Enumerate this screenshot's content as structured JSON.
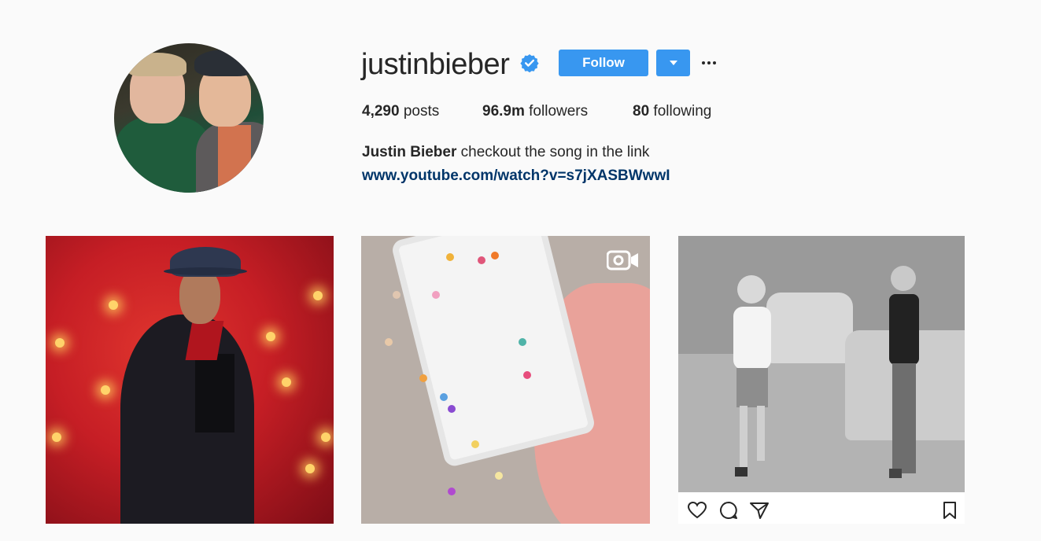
{
  "profile": {
    "username": "justinbieber",
    "verified": true,
    "follow_label": "Follow",
    "stats": {
      "posts_value": "4,290",
      "posts_label": "posts",
      "followers_value": "96.9m",
      "followers_label": "followers",
      "following_value": "80",
      "following_label": "following"
    },
    "bio_name": "Justin Bieber",
    "bio_text": "checkout the song in the link",
    "bio_link": "www.youtube.com/watch?v=s7jXASBWwwI"
  },
  "icons": {
    "verified": "verified-badge-icon",
    "dropdown": "chevron-down-icon",
    "more": "more-options-icon",
    "video": "video-camera-icon",
    "like": "heart-icon",
    "comment": "comment-icon",
    "share": "send-icon",
    "save": "bookmark-icon"
  },
  "colors": {
    "accent": "#3897f0",
    "link": "#003569",
    "background": "#fafafa"
  }
}
